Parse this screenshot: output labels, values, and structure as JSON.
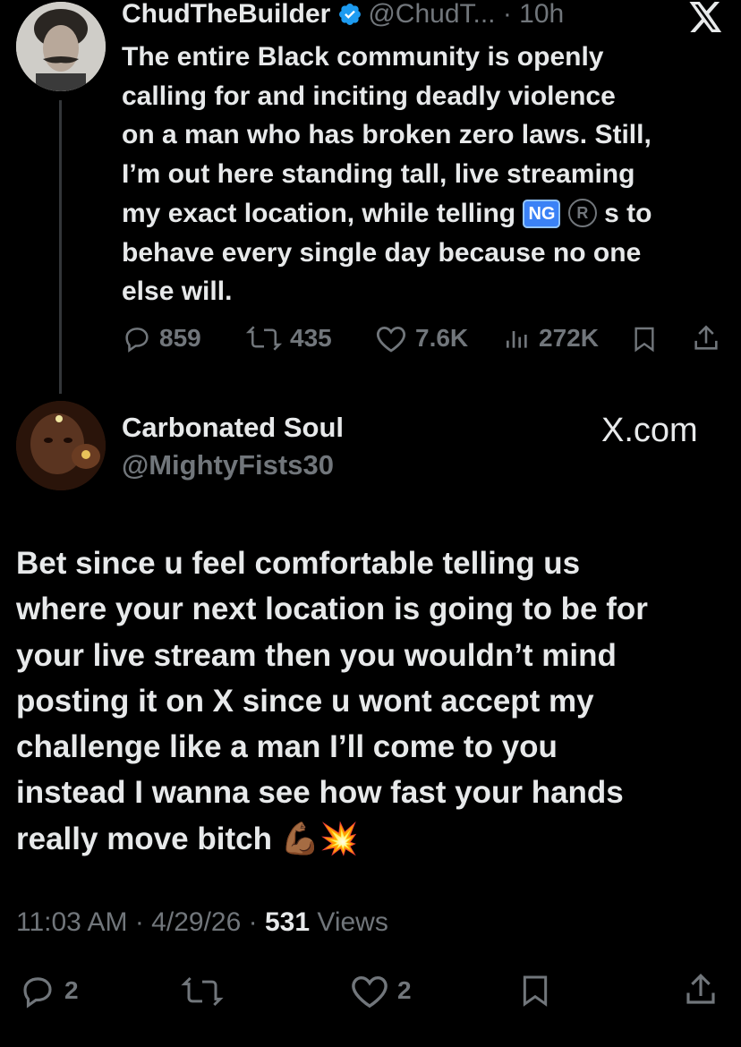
{
  "original_tweet": {
    "author_name": "ChudTheBuilder",
    "handle_time": "@ChudT... · 10h",
    "text_lines": [
      "The entire Black community is openly",
      "calling for and inciting deadly violence",
      "on a man who has broken zero laws. Still,",
      "I’m out here standing tall, live streaming",
      "my exact location, while telling",
      "behave every single day because no one",
      "else will."
    ],
    "emoji_ng": "NG",
    "emoji_r": "R",
    "text_after_emoji": "s to",
    "stats": {
      "replies": "859",
      "reposts": "435",
      "likes": "7.6K",
      "views": "272K"
    }
  },
  "reply_tweet": {
    "author_name": "Carbonated Soul",
    "handle": "@MightyFists30",
    "watermark": "X.com",
    "text_lines": [
      "Bet since u feel comfortable telling us",
      "where your next location is going to be for",
      "your live stream then you wouldn’t mind",
      "posting it on X since u wont accept my",
      "challenge like a man I’ll come to you",
      "instead I wanna see how fast your hands",
      "really move bitch"
    ],
    "emoji_suffix": "💪🏾💥",
    "timestamp": "11:03 AM · 4/29/26 · ",
    "views_count": "531",
    "views_label": " Views",
    "stats": {
      "replies": "2",
      "likes": "2"
    }
  },
  "icons": {
    "x_logo": "x-logo-icon",
    "verified": "verified-badge-icon",
    "reply": "reply-icon",
    "repost": "repost-icon",
    "like": "heart-icon",
    "views": "views-icon",
    "bookmark": "bookmark-icon",
    "share": "share-icon"
  },
  "colors": {
    "background": "#000000",
    "text": "#e7e9ea",
    "muted": "#71767b",
    "verified": "#1d9bf0"
  }
}
